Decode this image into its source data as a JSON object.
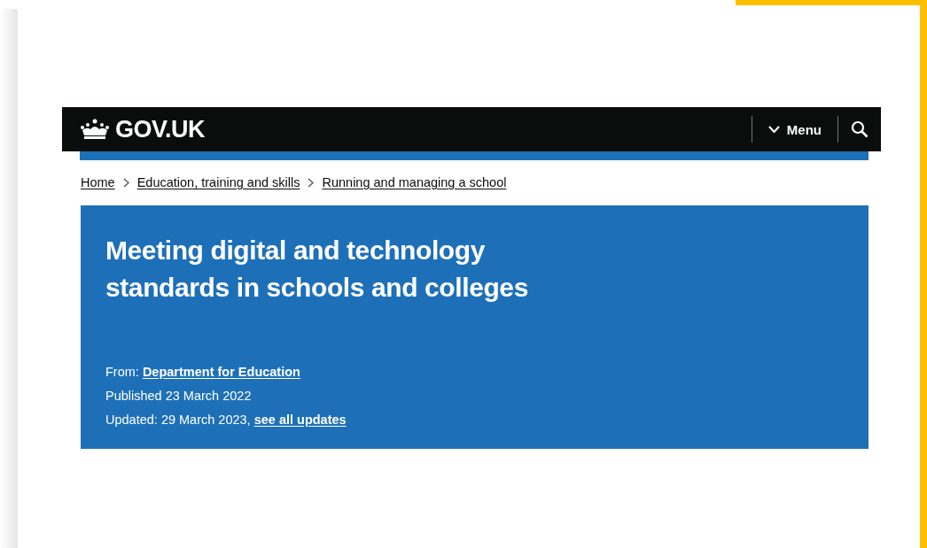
{
  "header": {
    "logo_text": "GOV.UK",
    "menu_label": "Menu"
  },
  "breadcrumbs": [
    {
      "label": "Home"
    },
    {
      "label": "Education, training and skills"
    },
    {
      "label": "Running and managing a school"
    }
  ],
  "title": "Meeting digital and technology standards in schools and colleges",
  "meta": {
    "from_label": "From:",
    "from_link": "Department for Education",
    "published": "Published 23 March 2022",
    "updated": "Updated: 29 March 2023,",
    "updates_link": "see all updates"
  }
}
